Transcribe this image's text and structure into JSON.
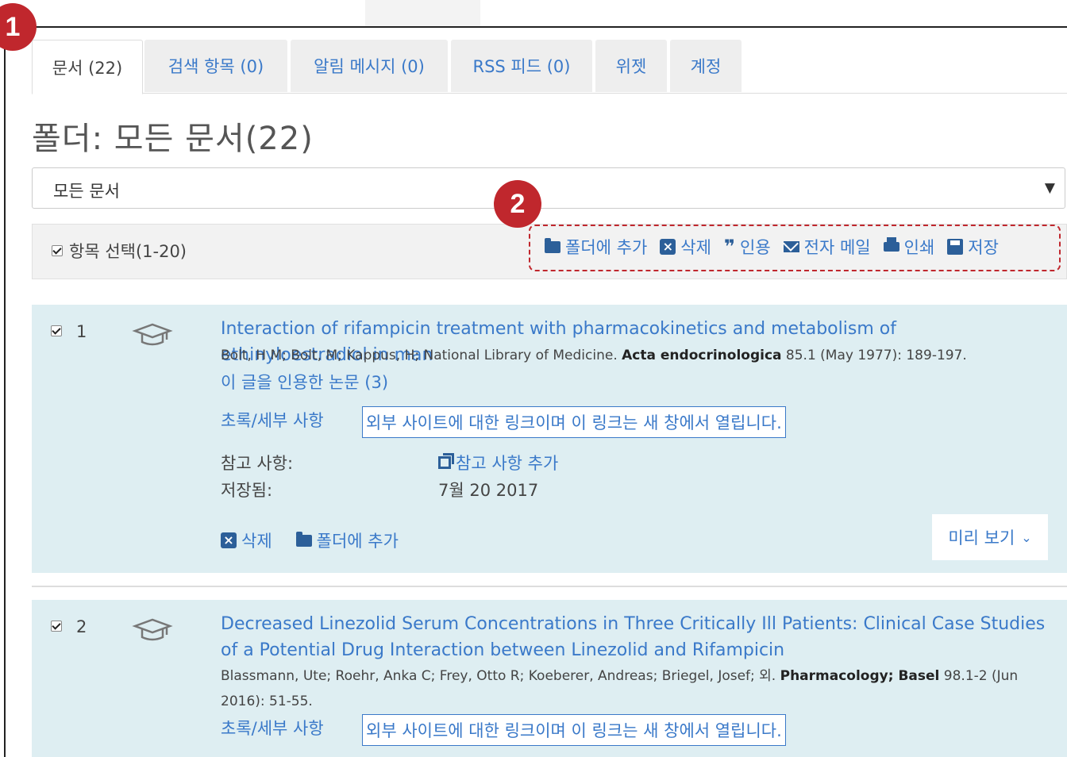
{
  "badges": {
    "one": "1",
    "two": "2"
  },
  "tabs": [
    {
      "label": "문서 (22)"
    },
    {
      "label": "검색 항목 (0)"
    },
    {
      "label": "알림 메시지 (0)"
    },
    {
      "label": "RSS 피드 (0)"
    },
    {
      "label": "위젯"
    },
    {
      "label": "계정"
    }
  ],
  "folder_title": "폴더: 모든 문서(22)",
  "folder_select": {
    "value": "모든 문서",
    "arrow": "▼"
  },
  "select_all": "항목 선택(1-20)",
  "toolbar": {
    "add_folder": "폴더에 추가",
    "delete": "삭제",
    "cite": "인용",
    "email": "전자 메일",
    "print": "인쇄",
    "save": "저장"
  },
  "results": [
    {
      "num": "1",
      "title": "Interaction of rifampicin treatment with pharmacokinetics and metabolism of ethinyloestradiol in man",
      "authors": "Bolt, H M; Bolt, M; Kappus, H; National Library of Medicine.",
      "journal": "Acta endocrinologica",
      "citation": "85.1 (May 1977): 189-197.",
      "cited_by": "이 글을 인용한 논문 (3)",
      "abstract_link": "초록/세부 사항",
      "external_link": "외부 사이트에 대한 링크이며 이 링크는 새 창에서 열립니다.",
      "notes_label": "참고 사항:",
      "notes_action": "참고 사항 추가",
      "saved_label": "저장됨:",
      "saved_date": "7월 20 2017",
      "delete": "삭제",
      "add_folder": "폴더에 추가",
      "preview": "미리 보기",
      "preview_chevron": "⌄"
    },
    {
      "num": "2",
      "title": "Decreased Linezolid Serum Concentrations in Three Critically Ill Patients: Clinical Case Studies of a Potential Drug Interaction between Linezolid and Rifampicin",
      "authors": "Blassmann, Ute; Roehr, Anka C; Frey, Otto R; Koeberer, Andreas; Briegel, Josef; 외.",
      "journal": "Pharmacology; Basel",
      "citation": "98.1-2 (Jun 2016): 51-55.",
      "abstract_link": "초록/세부 사항",
      "external_link": "외부 사이트에 대한 링크이며 이 링크는 새 창에서 열립니다."
    }
  ],
  "icons": {
    "folder": "folder-icon",
    "delete": "close-box-icon",
    "cite": "quote-icon",
    "email": "envelope-icon",
    "print": "printer-icon",
    "save": "floppy-disk-icon",
    "scholarly": "graduation-cap-icon",
    "notes": "copy-icon"
  },
  "colors": {
    "accent": "#3a79c9",
    "highlight": "#c0272d",
    "result_bg": "#deeef2"
  }
}
